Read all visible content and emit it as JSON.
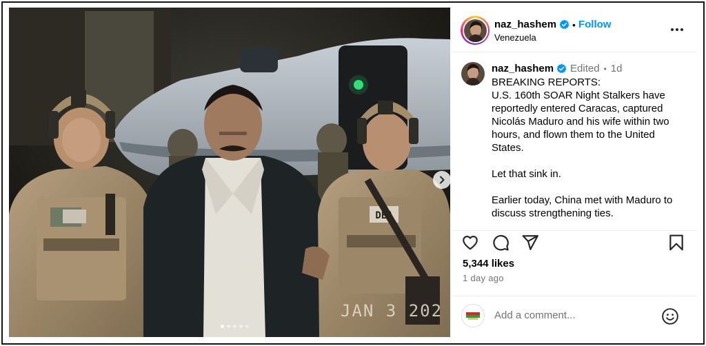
{
  "post": {
    "username": "naz_hashem",
    "location": "Venezuela",
    "follow_label": "Follow",
    "separator": "•",
    "more_label": "..."
  },
  "caption": {
    "username": "naz_hashem",
    "edited": "Edited",
    "dot": "•",
    "time": "1d",
    "text": "BREAKING REPORTS:\nU.S. 160th SOAR Night Stalkers have reportedly entered Caracas, captured Nicolás Maduro and his wife within two hours, and flown them to the United States.\n\nLet that sink in.\n\nEarlier today, China met with Maduro to discuss strengthening ties."
  },
  "media": {
    "datestamp": "JAN 3 202",
    "patch_text": "DEA",
    "carousel_count": 5,
    "carousel_active": 1
  },
  "stats": {
    "likes": "5,344 likes",
    "posted_ago": "1 day ago"
  },
  "comment": {
    "placeholder": "Add a comment..."
  },
  "icons": {
    "verified": "verified-badge-icon",
    "like": "heart-icon",
    "comment": "comment-icon",
    "share": "share-icon",
    "save": "bookmark-icon",
    "emoji": "emoji-icon",
    "next": "chevron-right-icon",
    "more": "more-options-icon"
  },
  "colors": {
    "accent": "#0095f6",
    "verified": "#0095f6",
    "muted": "#737373",
    "divider": "#efefef"
  }
}
